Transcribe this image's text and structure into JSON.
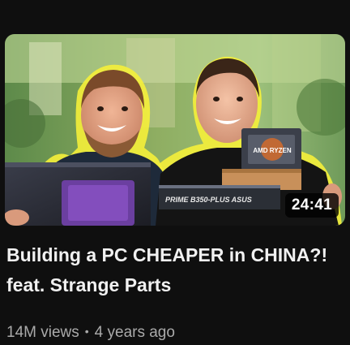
{
  "video": {
    "title": "Building a PC CHEAPER in CHINA?! feat. Strange Parts",
    "duration": "24:41",
    "views": "14M views",
    "separator": "•",
    "age": "4 years ago",
    "thumbnail": {
      "box_label": "AMD RYZEN",
      "motherboard_label": "PRIME B350-PLUS ASUS"
    }
  }
}
